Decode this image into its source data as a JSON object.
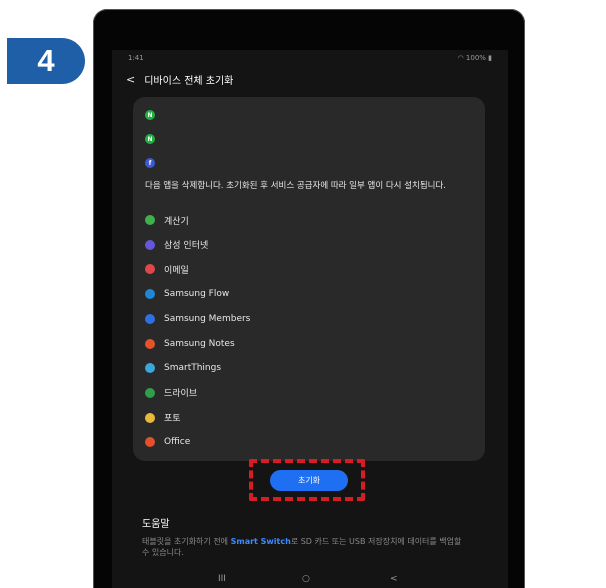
{
  "step_number": "4",
  "status": {
    "time": "1:41",
    "battery": "100%"
  },
  "header": {
    "title": "디바이스 전체 초기화"
  },
  "card": {
    "notice": "다음 앱을 삭제합니다. 초기화된 후 서비스 공급자에 따라 일부 앱이 다시 설치됩니다.",
    "apps": [
      {
        "label": "계산기",
        "icon": "calculator-icon",
        "color": "#3fb14b"
      },
      {
        "label": "삼성 인터넷",
        "icon": "internet-icon",
        "color": "#6657d8"
      },
      {
        "label": "이메일",
        "icon": "email-icon",
        "color": "#e04848"
      },
      {
        "label": "Samsung Flow",
        "icon": "flow-icon",
        "color": "#1e88d6"
      },
      {
        "label": "Samsung Members",
        "icon": "members-icon",
        "color": "#2f6fe0"
      },
      {
        "label": "Samsung Notes",
        "icon": "notes-icon",
        "color": "#e6522a"
      },
      {
        "label": "SmartThings",
        "icon": "smartthings-icon",
        "color": "#3aa6dc"
      },
      {
        "label": "드라이브",
        "icon": "drive-icon",
        "color": "#2ea04c"
      },
      {
        "label": "포토",
        "icon": "photos-icon",
        "color": "#e8b93a"
      },
      {
        "label": "Office",
        "icon": "office-icon",
        "color": "#e4502a"
      }
    ]
  },
  "reset_button": {
    "label": "초기화",
    "color": "#1f6ff2"
  },
  "help": {
    "title": "도움말",
    "text_before": "태블릿을 초기화하기 전에 ",
    "text_accent": "Smart Switch",
    "text_after": "로 SD 카드 또는 USB 저장장치에 데이터를 백업할 수 있습니다."
  },
  "nav": {
    "recents": "III",
    "home": "○",
    "back": "<"
  },
  "colors": {
    "highlight": "#d81c24",
    "badge": "#1f5fa8"
  }
}
